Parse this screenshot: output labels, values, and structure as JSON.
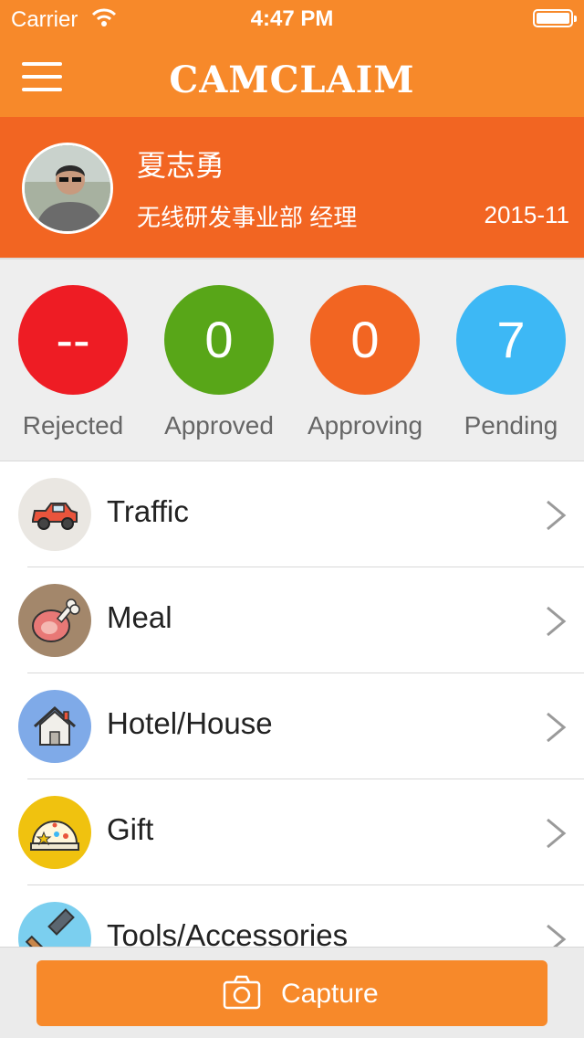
{
  "status_bar": {
    "carrier": "Carrier",
    "time": "4:47 PM"
  },
  "nav": {
    "logo": "CAMCLAIM"
  },
  "profile": {
    "name": "夏志勇",
    "department": "无线研发事业部 经理",
    "period": "2015-11"
  },
  "stats": [
    {
      "value": "--",
      "label": "Rejected",
      "color": "#EE1C24"
    },
    {
      "value": "0",
      "label": "Approved",
      "color": "#58A618"
    },
    {
      "value": "0",
      "label": "Approving",
      "color": "#F26522"
    },
    {
      "value": "7",
      "label": "Pending",
      "color": "#3DB8F5"
    }
  ],
  "categories": [
    {
      "label": "Traffic",
      "icon": "car-icon",
      "bg": "#EAE7E2"
    },
    {
      "label": "Meal",
      "icon": "meat-icon",
      "bg": "#A3876B"
    },
    {
      "label": "Hotel/House",
      "icon": "house-icon",
      "bg": "#7FAAE8"
    },
    {
      "label": "Gift",
      "icon": "gift-icon",
      "bg": "#F0C20F"
    },
    {
      "label": "Tools/Accessories",
      "icon": "hammer-icon",
      "bg": "#7BCFEF"
    }
  ],
  "bottom": {
    "capture_label": "Capture"
  },
  "colors": {
    "header": "#F7892A",
    "profile_bg": "#F26522",
    "accent": "#F7892A"
  }
}
